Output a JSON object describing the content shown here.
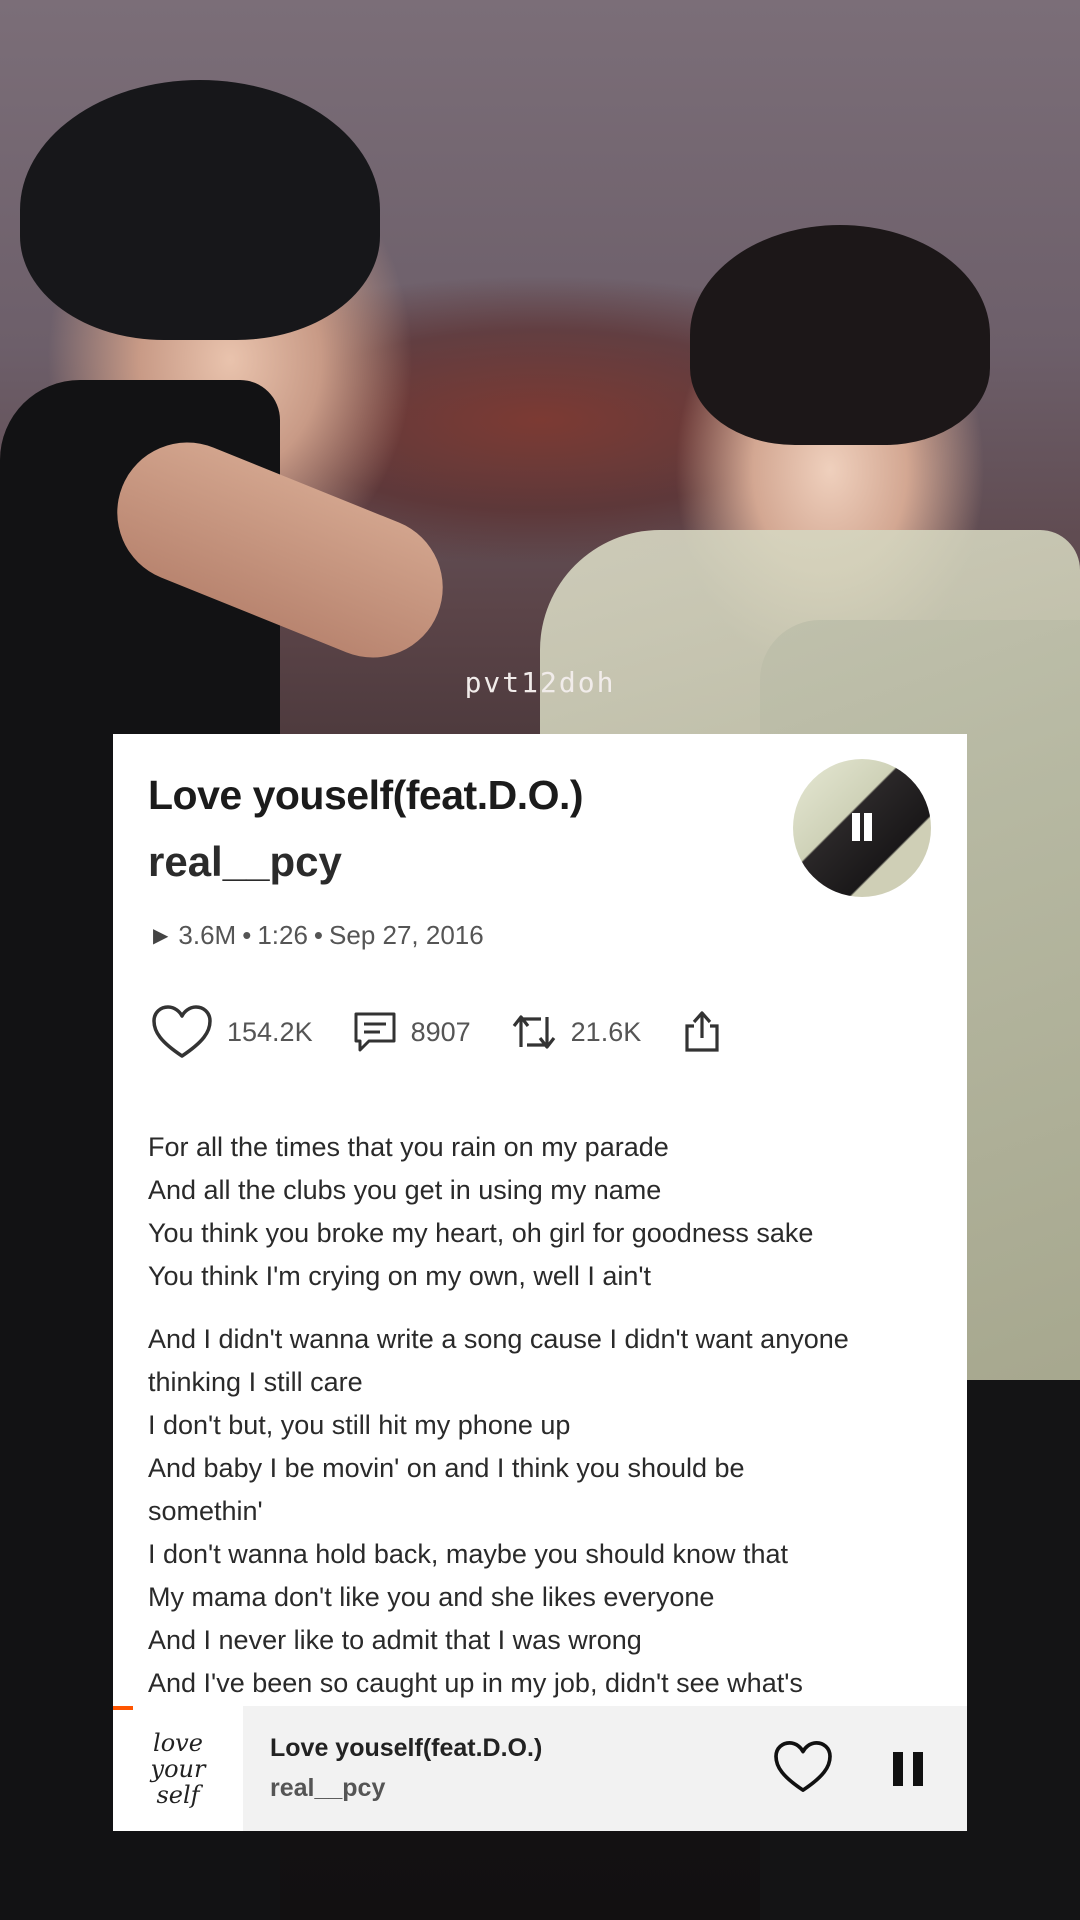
{
  "watermark": "pvt12doh",
  "track": {
    "title": "Love youself(feat.D.O.)",
    "artist": "real__pcy",
    "plays": "3.6M",
    "duration": "1:26",
    "date": "Sep 27, 2016",
    "separator": "•"
  },
  "actions": {
    "likes": "154.2K",
    "comments": "8907",
    "reposts": "21.6K"
  },
  "icons": {
    "play": "play-icon",
    "like": "heart-icon",
    "comment": "comment-icon",
    "repost": "repost-icon",
    "share": "share-icon",
    "pause": "pause-icon"
  },
  "lyrics": {
    "stanza1": [
      "For all the times that you rain on my parade",
      "And all the clubs you get in using my name",
      "You think you broke my heart, oh girl for goodness sake",
      "You think I'm crying on my own, well I ain't"
    ],
    "stanza2": [
      "And I didn't wanna write a song cause I didn't want anyone",
      "thinking I still care",
      "I don't but, you still hit my phone up",
      "And baby I be movin' on and I think you should be",
      "somethin'",
      "I don't wanna hold back, maybe you should know that",
      "My mama don't like you and she likes everyone",
      "And I never like to admit that I was wrong",
      "And I've been so caught up in my job, didn't see what's"
    ]
  },
  "mini_player": {
    "art_text": [
      "love",
      "your",
      "self"
    ],
    "title": "Love youself(feat.D.O.)",
    "artist": "real__pcy"
  },
  "colors": {
    "accent": "#ff5500",
    "card": "#ffffff",
    "mini_player_bg": "#f2f2f2"
  }
}
